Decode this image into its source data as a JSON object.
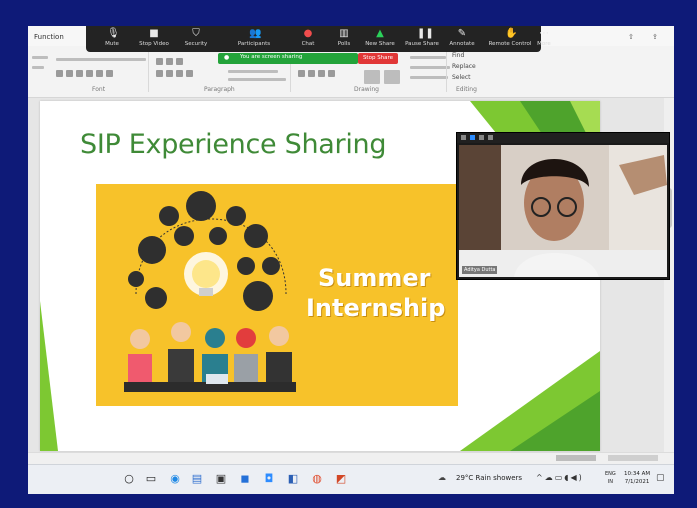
{
  "ribbon": {
    "first_tab": "Function",
    "groups": [
      "Font",
      "Paragraph",
      "Drawing",
      "Editing"
    ],
    "editing": [
      "Find",
      "Replace",
      "Select"
    ]
  },
  "zoom_toolbar": {
    "buttons": [
      {
        "label": "Mute",
        "icon": "microphone-icon"
      },
      {
        "label": "Stop Video",
        "icon": "camera-icon"
      },
      {
        "label": "Security",
        "icon": "shield-icon"
      },
      {
        "label": "Participants",
        "icon": "participants-icon"
      },
      {
        "label": "Chat",
        "icon": "chat-icon"
      },
      {
        "label": "Polls",
        "icon": "polls-icon"
      },
      {
        "label": "New Share",
        "icon": "share-icon"
      },
      {
        "label": "Pause Share",
        "icon": "pause-icon"
      },
      {
        "label": "Annotate",
        "icon": "pen-icon"
      },
      {
        "label": "Remote Control",
        "icon": "remote-icon"
      },
      {
        "label": "More",
        "icon": "more-icon"
      }
    ],
    "sharing_banner": "You are screen sharing",
    "stop_share": "Stop Share"
  },
  "slide": {
    "title": "SIP Experience Sharing",
    "banner_line1": "Summer",
    "banner_line2": "Internship"
  },
  "video": {
    "participant_name": "Aditya Dutta"
  },
  "taskbar": {
    "weather": "29°C  Rain showers",
    "language": "ENG",
    "language_region": "IN",
    "time": "10:34 AM",
    "date": "7/1/2021"
  },
  "colors": {
    "title_green": "#3f8a37",
    "banner_yellow": "#f7c22a",
    "accent_green": "#7dc832",
    "border_blue": "#0e1a78"
  }
}
